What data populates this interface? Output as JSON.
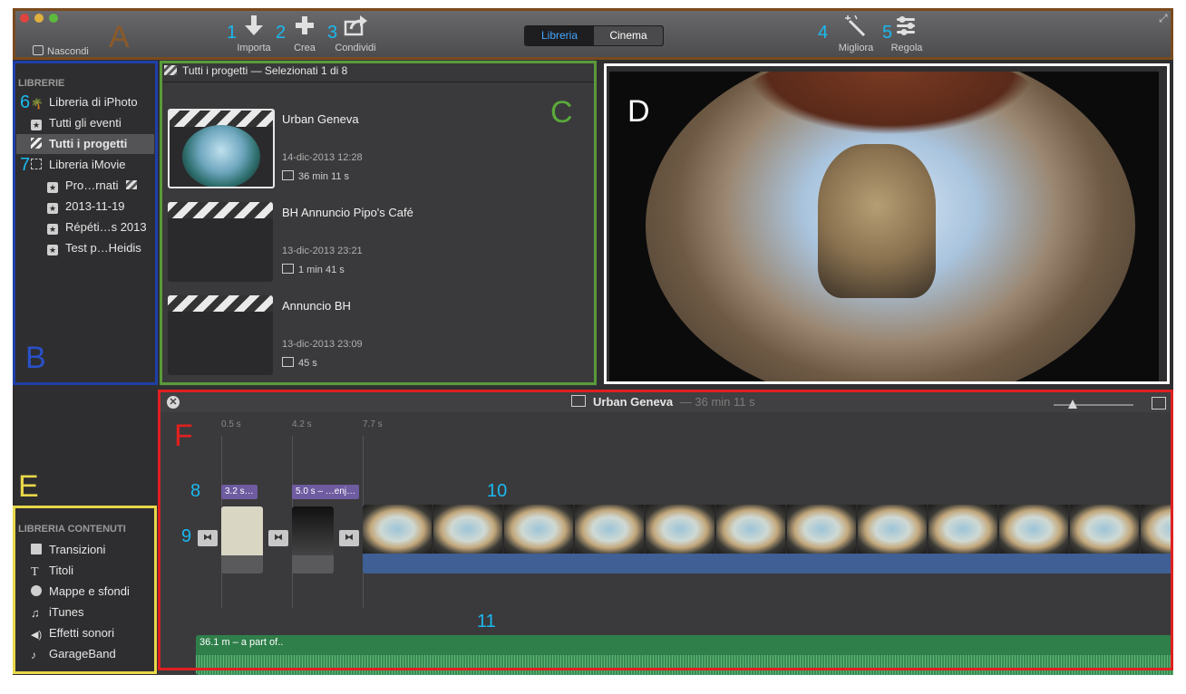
{
  "toolbar": {
    "hide_label": "Nascondi",
    "import_label": "Importa",
    "create_label": "Crea",
    "share_label": "Condividi",
    "library_tab": "Libreria",
    "cinema_tab": "Cinema",
    "enhance_label": "Migliora",
    "adjust_label": "Regola"
  },
  "sidebar": {
    "section_title": "LIBRERIE",
    "items": [
      {
        "label": "Libreria di iPhoto"
      },
      {
        "label": "Tutti gli eventi"
      },
      {
        "label": "Tutti i progetti"
      },
      {
        "label": "Libreria iMovie"
      },
      {
        "label": "Pro…rnati"
      },
      {
        "label": "2013-11-19"
      },
      {
        "label": "Répéti…s 2013"
      },
      {
        "label": "Test p…Heidis"
      }
    ]
  },
  "project_list": {
    "header": "Tutti i progetti — Selezionati 1 di 8",
    "projects": [
      {
        "title": "Urban Geneva",
        "date": "14-dic-2013 12:28",
        "duration": "36 min 11 s"
      },
      {
        "title": "BH Annuncio Pipo's Café",
        "date": "13-dic-2013 23:21",
        "duration": "1 min 41 s"
      },
      {
        "title": "Annuncio BH",
        "date": "13-dic-2013 23:09",
        "duration": "45 s"
      }
    ]
  },
  "content_library": {
    "section_title": "LIBRERIA CONTENUTI",
    "items": [
      {
        "label": "Transizioni"
      },
      {
        "label": "Titoli"
      },
      {
        "label": "Mappe e sfondi"
      },
      {
        "label": "iTunes"
      },
      {
        "label": "Effetti sonori"
      },
      {
        "label": "GarageBand"
      }
    ]
  },
  "timeline": {
    "project_title": "Urban Geneva",
    "project_duration": "— 36 min 11 s",
    "ruler": [
      "0.5 s",
      "4.2 s",
      "7.7 s"
    ],
    "title_clip_1": "3.2 s…",
    "title_clip_2": "5.0 s – …enj…",
    "audio_clip": "36.1 m – a part of.."
  },
  "annotations": {
    "letters": [
      "A",
      "B",
      "C",
      "D",
      "E",
      "F"
    ],
    "numbers": [
      "1",
      "2",
      "3",
      "4",
      "5",
      "6",
      "7",
      "8",
      "9",
      "10",
      "11"
    ]
  },
  "colors": {
    "annotation_number": "#1ab9f0",
    "box_A": "#7a4a1e",
    "box_B": "#1f3fa8",
    "box_C": "#5a9a3a",
    "box_D": "#ffffff",
    "box_E": "#e8d84a",
    "box_F": "#e02020",
    "audio_track": "#2f7f4a",
    "video_track": "#3f5f95",
    "title_tag": "#6e5ba0"
  }
}
